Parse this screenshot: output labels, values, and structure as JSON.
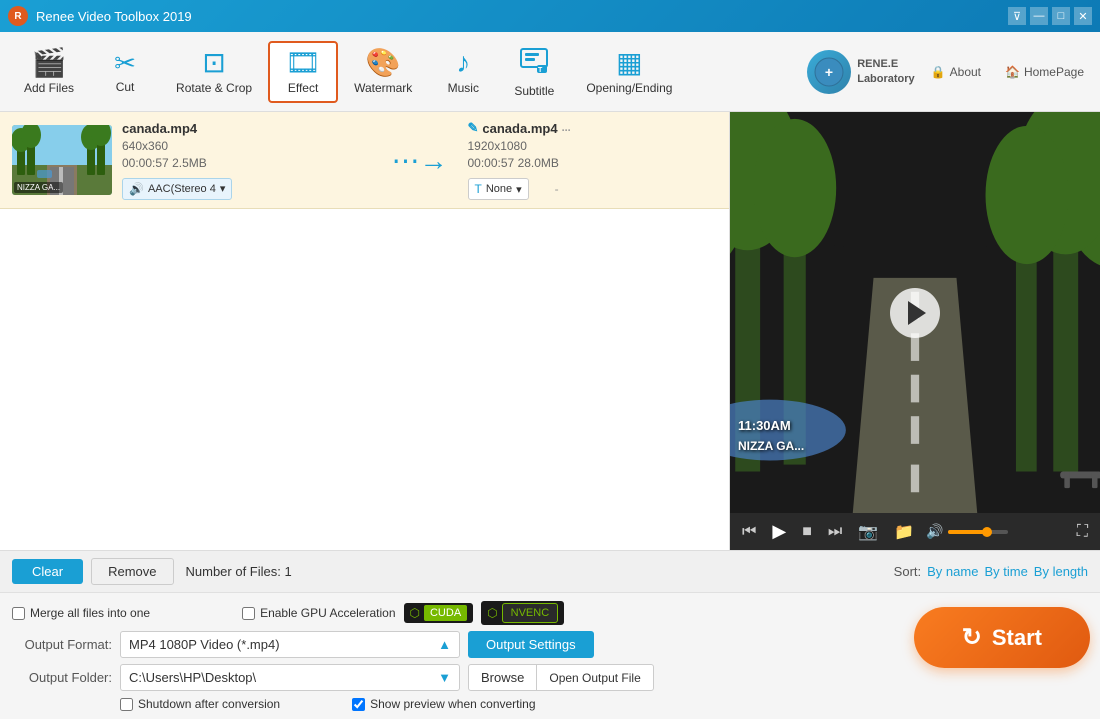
{
  "app": {
    "title": "Renee Video Toolbox 2019",
    "logo_text": "R"
  },
  "title_bar": {
    "title": "Renee Video Toolbox 2019",
    "minimize": "—",
    "maximize": "□",
    "close": "✕"
  },
  "toolbar": {
    "items": [
      {
        "id": "add-files",
        "label": "Add Files",
        "icon": "🎬",
        "active": false
      },
      {
        "id": "cut",
        "label": "Cut",
        "icon": "✂",
        "active": false
      },
      {
        "id": "rotate-crop",
        "label": "Rotate & Crop",
        "icon": "⊡",
        "active": false
      },
      {
        "id": "effect",
        "label": "Effect",
        "icon": "🎞",
        "active": true
      },
      {
        "id": "watermark",
        "label": "Watermark",
        "icon": "🎨",
        "active": false
      },
      {
        "id": "music",
        "label": "Music",
        "icon": "♪",
        "active": false
      },
      {
        "id": "subtitle",
        "label": "Subtitle",
        "icon": "📝",
        "active": false
      },
      {
        "id": "opening-ending",
        "label": "Opening/Ending",
        "icon": "▦",
        "active": false
      }
    ],
    "about_label": "About",
    "homepage_label": "HomePage",
    "brand_line1": "RENE.E",
    "brand_line2": "Laboratory"
  },
  "file_item": {
    "input_filename": "canada.mp4",
    "input_resolution": "640x360",
    "input_duration": "00:00:57",
    "input_size": "2.5MB",
    "output_filename": "canada.mp4",
    "output_resolution": "1920x1080",
    "output_duration": "00:00:57",
    "output_size": "28.0MB",
    "audio_track": "AAC(Stereo 4",
    "subtitle_track": "None",
    "output_extra": "..."
  },
  "video_preview": {
    "time_overlay": "11:30AM",
    "location_overlay": "NIZZA GA...",
    "play_icon": "▶"
  },
  "video_controls": {
    "skip_back": "⏮",
    "play": "▶",
    "stop": "■",
    "skip_forward": "⏭",
    "screenshot": "📷",
    "folder": "📁",
    "volume": "🔊",
    "volume_level": 60,
    "fullscreen": "⛶"
  },
  "bottom_bar": {
    "clear_label": "Clear",
    "remove_label": "Remove",
    "file_count_label": "Number of Files:",
    "file_count": "1",
    "sort_label": "Sort:",
    "sort_by_name": "By name",
    "sort_by_time": "By time",
    "sort_by_length": "By length"
  },
  "settings": {
    "merge_label": "Merge all files into one",
    "gpu_label": "Enable GPU Acceleration",
    "cuda_label": "CUDA",
    "nvenc_label": "NVENC",
    "output_format_label": "Output Format:",
    "output_format_value": "MP4 1080P Video (*.mp4)",
    "output_settings_label": "Output Settings",
    "output_folder_label": "Output Folder:",
    "output_folder_value": "C:\\Users\\HP\\Desktop\\",
    "browse_label": "Browse",
    "open_output_label": "Open Output File",
    "shutdown_label": "Shutdown after conversion",
    "show_preview_label": "Show preview when converting",
    "start_label": "Start"
  }
}
